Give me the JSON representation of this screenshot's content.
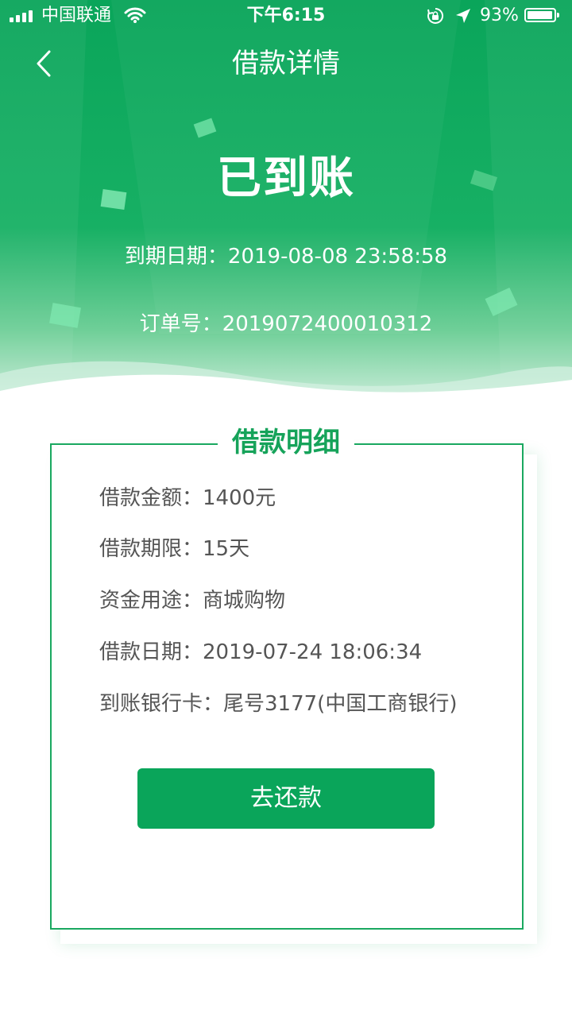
{
  "status_bar": {
    "carrier": "中国联通",
    "time": "下午6:15",
    "battery_percent": "93%",
    "battery_level": 0.93,
    "icons": [
      "signal-icon",
      "wifi-icon",
      "orientation-lock-icon",
      "location-arrow-icon",
      "battery-icon"
    ]
  },
  "nav": {
    "title": "借款详情",
    "back_icon": "chevron-left-icon"
  },
  "hero": {
    "status": "已到账",
    "due_date": "到期日期：2019-08-08 23:58:58",
    "order_no": "订单号：2019072400010312"
  },
  "details": {
    "title": "借款明细",
    "rows": [
      {
        "label": "借款金额：",
        "value": "1400元"
      },
      {
        "label": "借款期限：",
        "value": "15天"
      },
      {
        "label": "资金用途：",
        "value": "商城购物"
      },
      {
        "label": "借款日期：",
        "value": "2019-07-24 18:06:34"
      },
      {
        "label": "到账银行卡：",
        "value": "尾号3177(中国工商银行)"
      }
    ],
    "button_label": "去还款"
  },
  "colors": {
    "brand_green": "#0aa55a",
    "text_gray": "#555555",
    "white": "#ffffff"
  }
}
